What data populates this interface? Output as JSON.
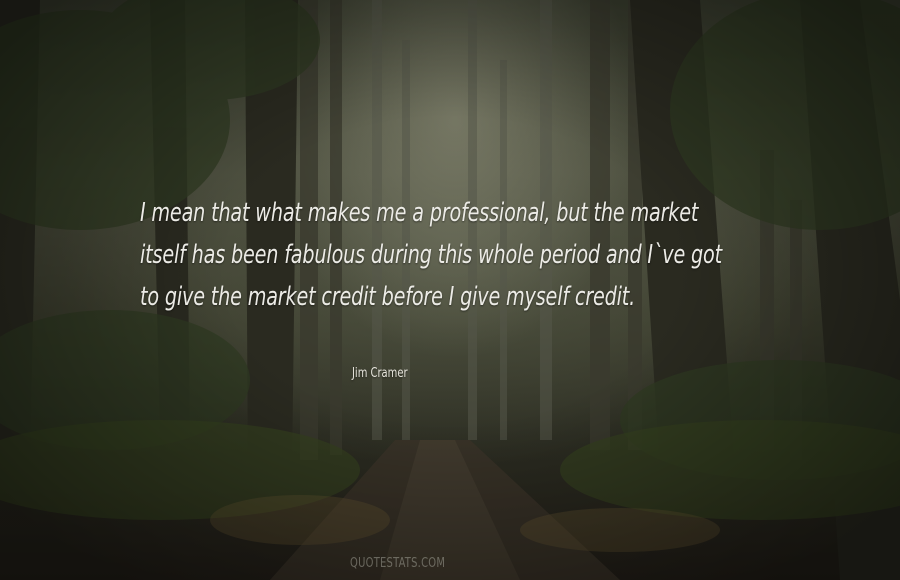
{
  "quote": {
    "lines": [
      "I mean that what makes me a professional, but the market",
      "itself has been fabulous during this whole period and I`ve got",
      "to give the market credit before I give myself credit."
    ]
  },
  "author": "Jim Cramer",
  "watermark": "QUOTESTATS.COM"
}
